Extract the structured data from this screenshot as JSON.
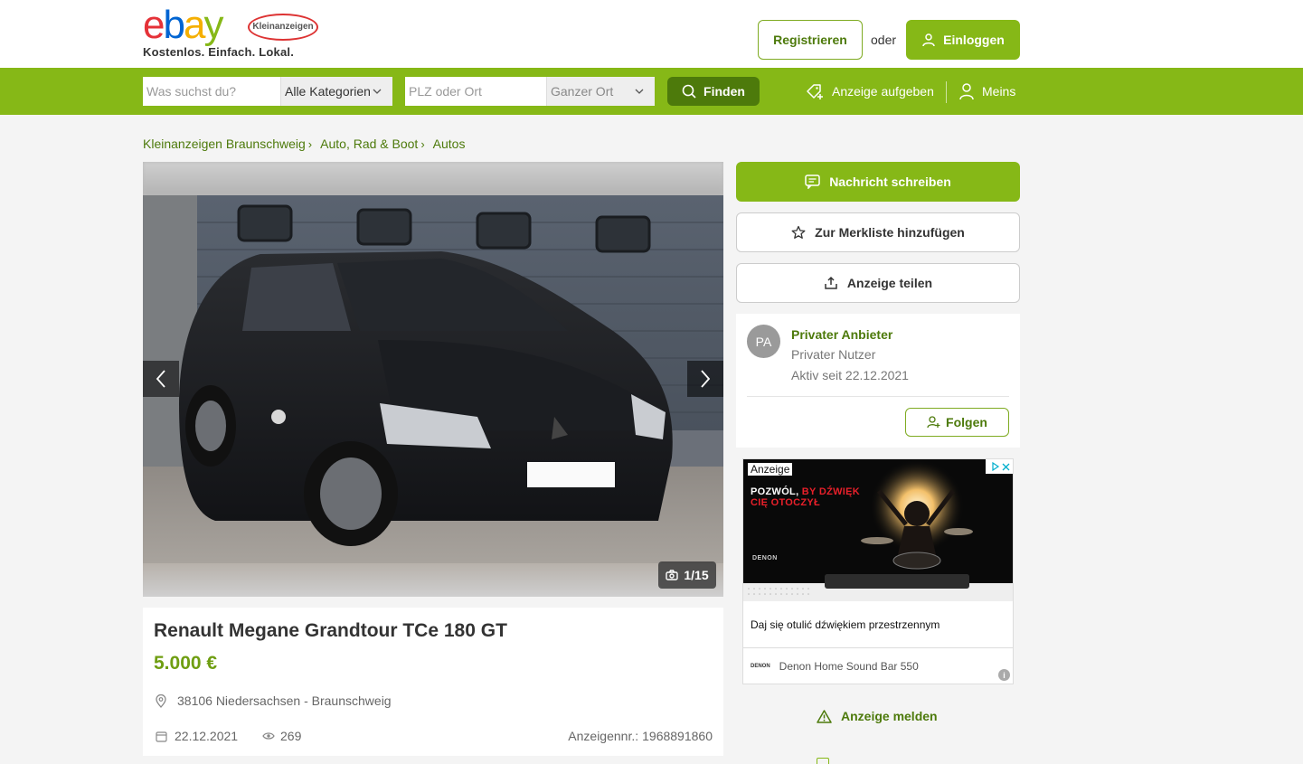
{
  "brand": {
    "ebay_letters": [
      "e",
      "b",
      "a",
      "y"
    ],
    "sub_logo": "Kleinanzeigen",
    "tagline": "Kostenlos. Einfach. Lokal."
  },
  "header": {
    "register_label": "Registrieren",
    "or_label": "oder",
    "login_label": "Einloggen"
  },
  "search": {
    "query_placeholder": "Was suchst du?",
    "category_value": "Alle Kategorien",
    "location_placeholder": "PLZ oder Ort",
    "radius_value": "Ganzer Ort",
    "find_label": "Finden",
    "post_ad_label": "Anzeige aufgeben",
    "account_label": "Meins"
  },
  "breadcrumb": [
    {
      "label": "Kleinanzeigen Braunschweig"
    },
    {
      "label": "Auto, Rad & Boot"
    },
    {
      "label": "Autos"
    }
  ],
  "gallery": {
    "counter": "1/15"
  },
  "listing": {
    "title": "Renault Megane Grandtour TCe 180 GT",
    "price": "5.000 €",
    "location": "38106 Niedersachsen - Braunschweig",
    "date": "22.12.2021",
    "views": "269",
    "ad_id_label": "Anzeigennr.:",
    "ad_id": "1968891860"
  },
  "actions": {
    "message_label": "Nachricht schreiben",
    "watchlist_label": "Zur Merkliste hinzufügen",
    "share_label": "Anzeige teilen",
    "report_label": "Anzeige melden"
  },
  "seller": {
    "initials": "PA",
    "name": "Privater Anbieter",
    "type": "Privater Nutzer",
    "active_since": "Aktiv seit 22.12.2021",
    "follow_label": "Folgen"
  },
  "advert": {
    "label": "Anzeige",
    "headline_white_1": "POZWÓL,",
    "headline_red_1": "BY DŹWIĘK",
    "headline_red_2": "CIĘ OTOCZYŁ",
    "brand": "DENON",
    "text": "Daj się otulić dźwiękiem przestrzennym",
    "product_brand": "DENON",
    "product": "Denon Home Sound Bar 550"
  },
  "colors": {
    "brand_green": "#86b817",
    "dark_green": "#4d7a0b",
    "price_green": "#6f9e12"
  }
}
